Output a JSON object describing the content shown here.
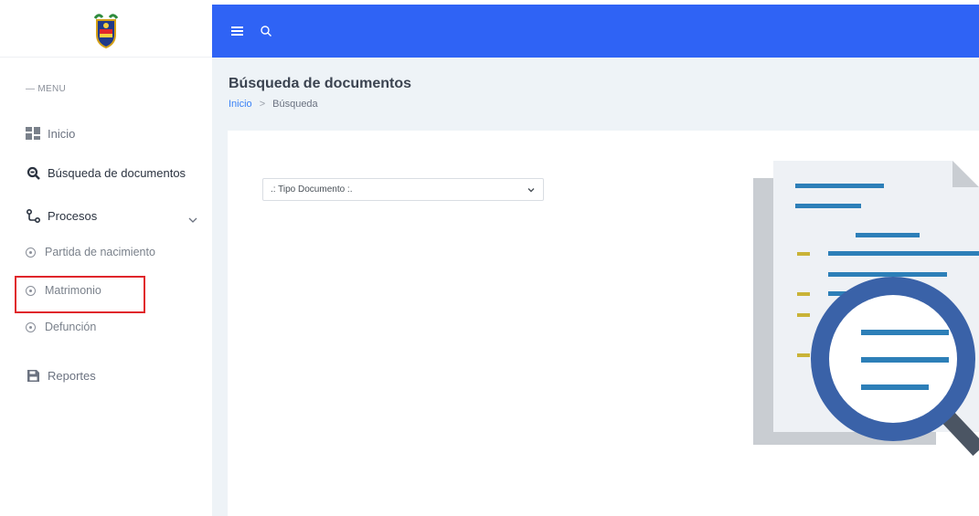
{
  "sidebar": {
    "menu_title": "— MENU",
    "items": [
      {
        "label": "Inicio",
        "icon": "dashboard-icon"
      },
      {
        "label": "Búsqueda de documentos",
        "icon": "search-document-icon"
      },
      {
        "label": "Procesos",
        "icon": "process-icon"
      },
      {
        "label": "Partida de nacimiento",
        "icon": "circle-bullet-icon"
      },
      {
        "label": "Matrimonio",
        "icon": "circle-bullet-icon"
      },
      {
        "label": "Defunción",
        "icon": "circle-bullet-icon"
      },
      {
        "label": "Reportes",
        "icon": "report-icon"
      }
    ]
  },
  "header": {
    "page_title": "Búsqueda de documentos",
    "breadcrumb": [
      "Inicio",
      "Búsqueda"
    ]
  },
  "form": {
    "tipo_documento": ".: Tipo Documento :."
  },
  "colors": {
    "topbar": "#2f63f5",
    "highlight": "#e0262b",
    "content_bg": "#eef3f7",
    "illustration_blue": "#3a62a8",
    "line_blue": "#2d7fb8"
  }
}
